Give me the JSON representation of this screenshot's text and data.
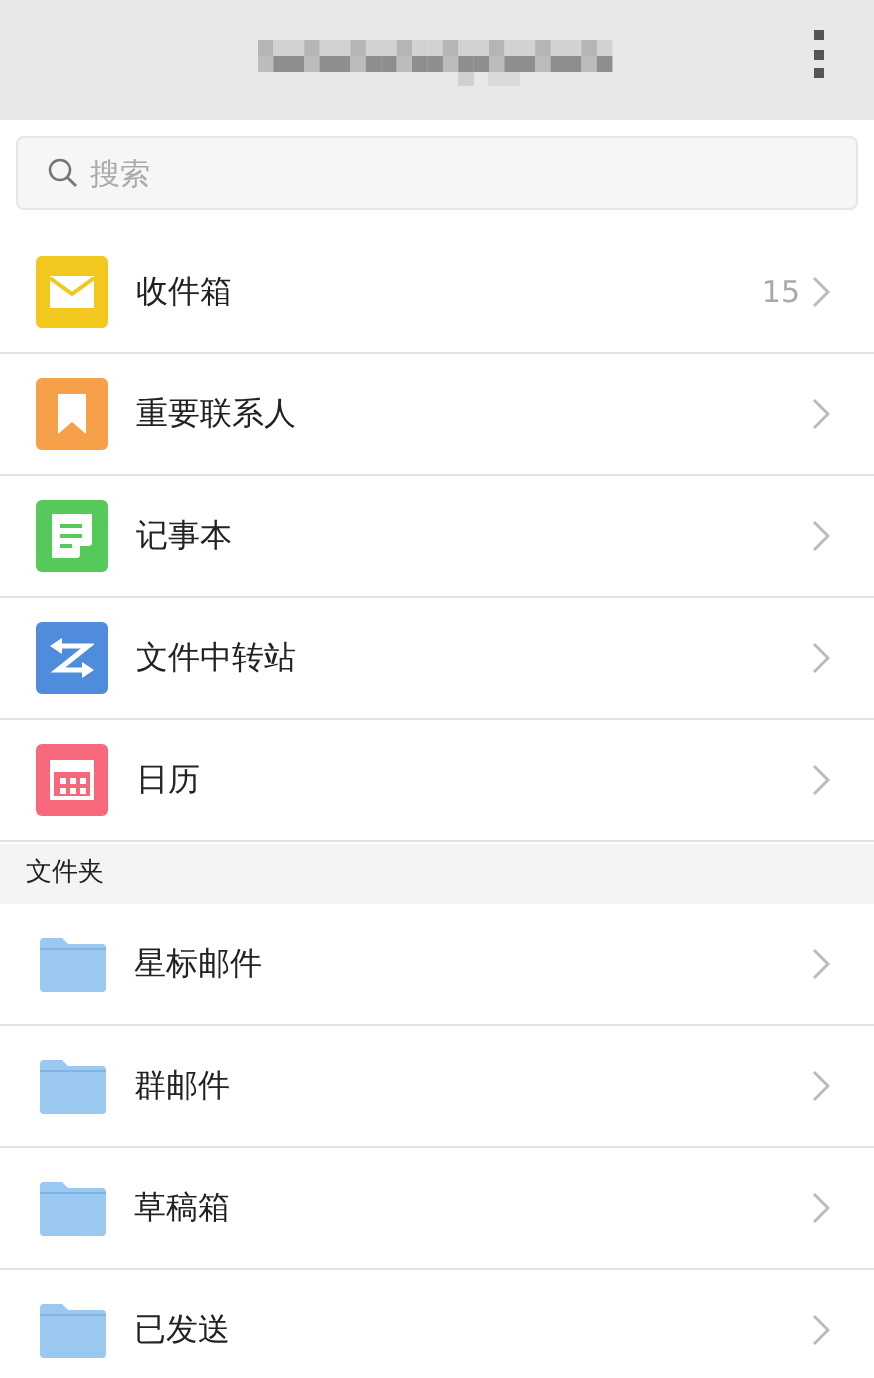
{
  "search": {
    "placeholder": "搜索"
  },
  "items": [
    {
      "label": "收件箱",
      "kind": "mail",
      "color": "#f2c81e",
      "count": "15"
    },
    {
      "label": "重要联系人",
      "kind": "bookmark",
      "color": "#f7a04a"
    },
    {
      "label": "记事本",
      "kind": "note",
      "color": "#55c95a"
    },
    {
      "label": "文件中转站",
      "kind": "transfer",
      "color": "#4f8ddc"
    },
    {
      "label": "日历",
      "kind": "calendar",
      "color": "#f8687c"
    }
  ],
  "folders_section": {
    "title": "文件夹"
  },
  "folders": [
    {
      "label": "星标邮件"
    },
    {
      "label": "群邮件"
    },
    {
      "label": "草稿箱"
    },
    {
      "label": "已发送"
    }
  ]
}
